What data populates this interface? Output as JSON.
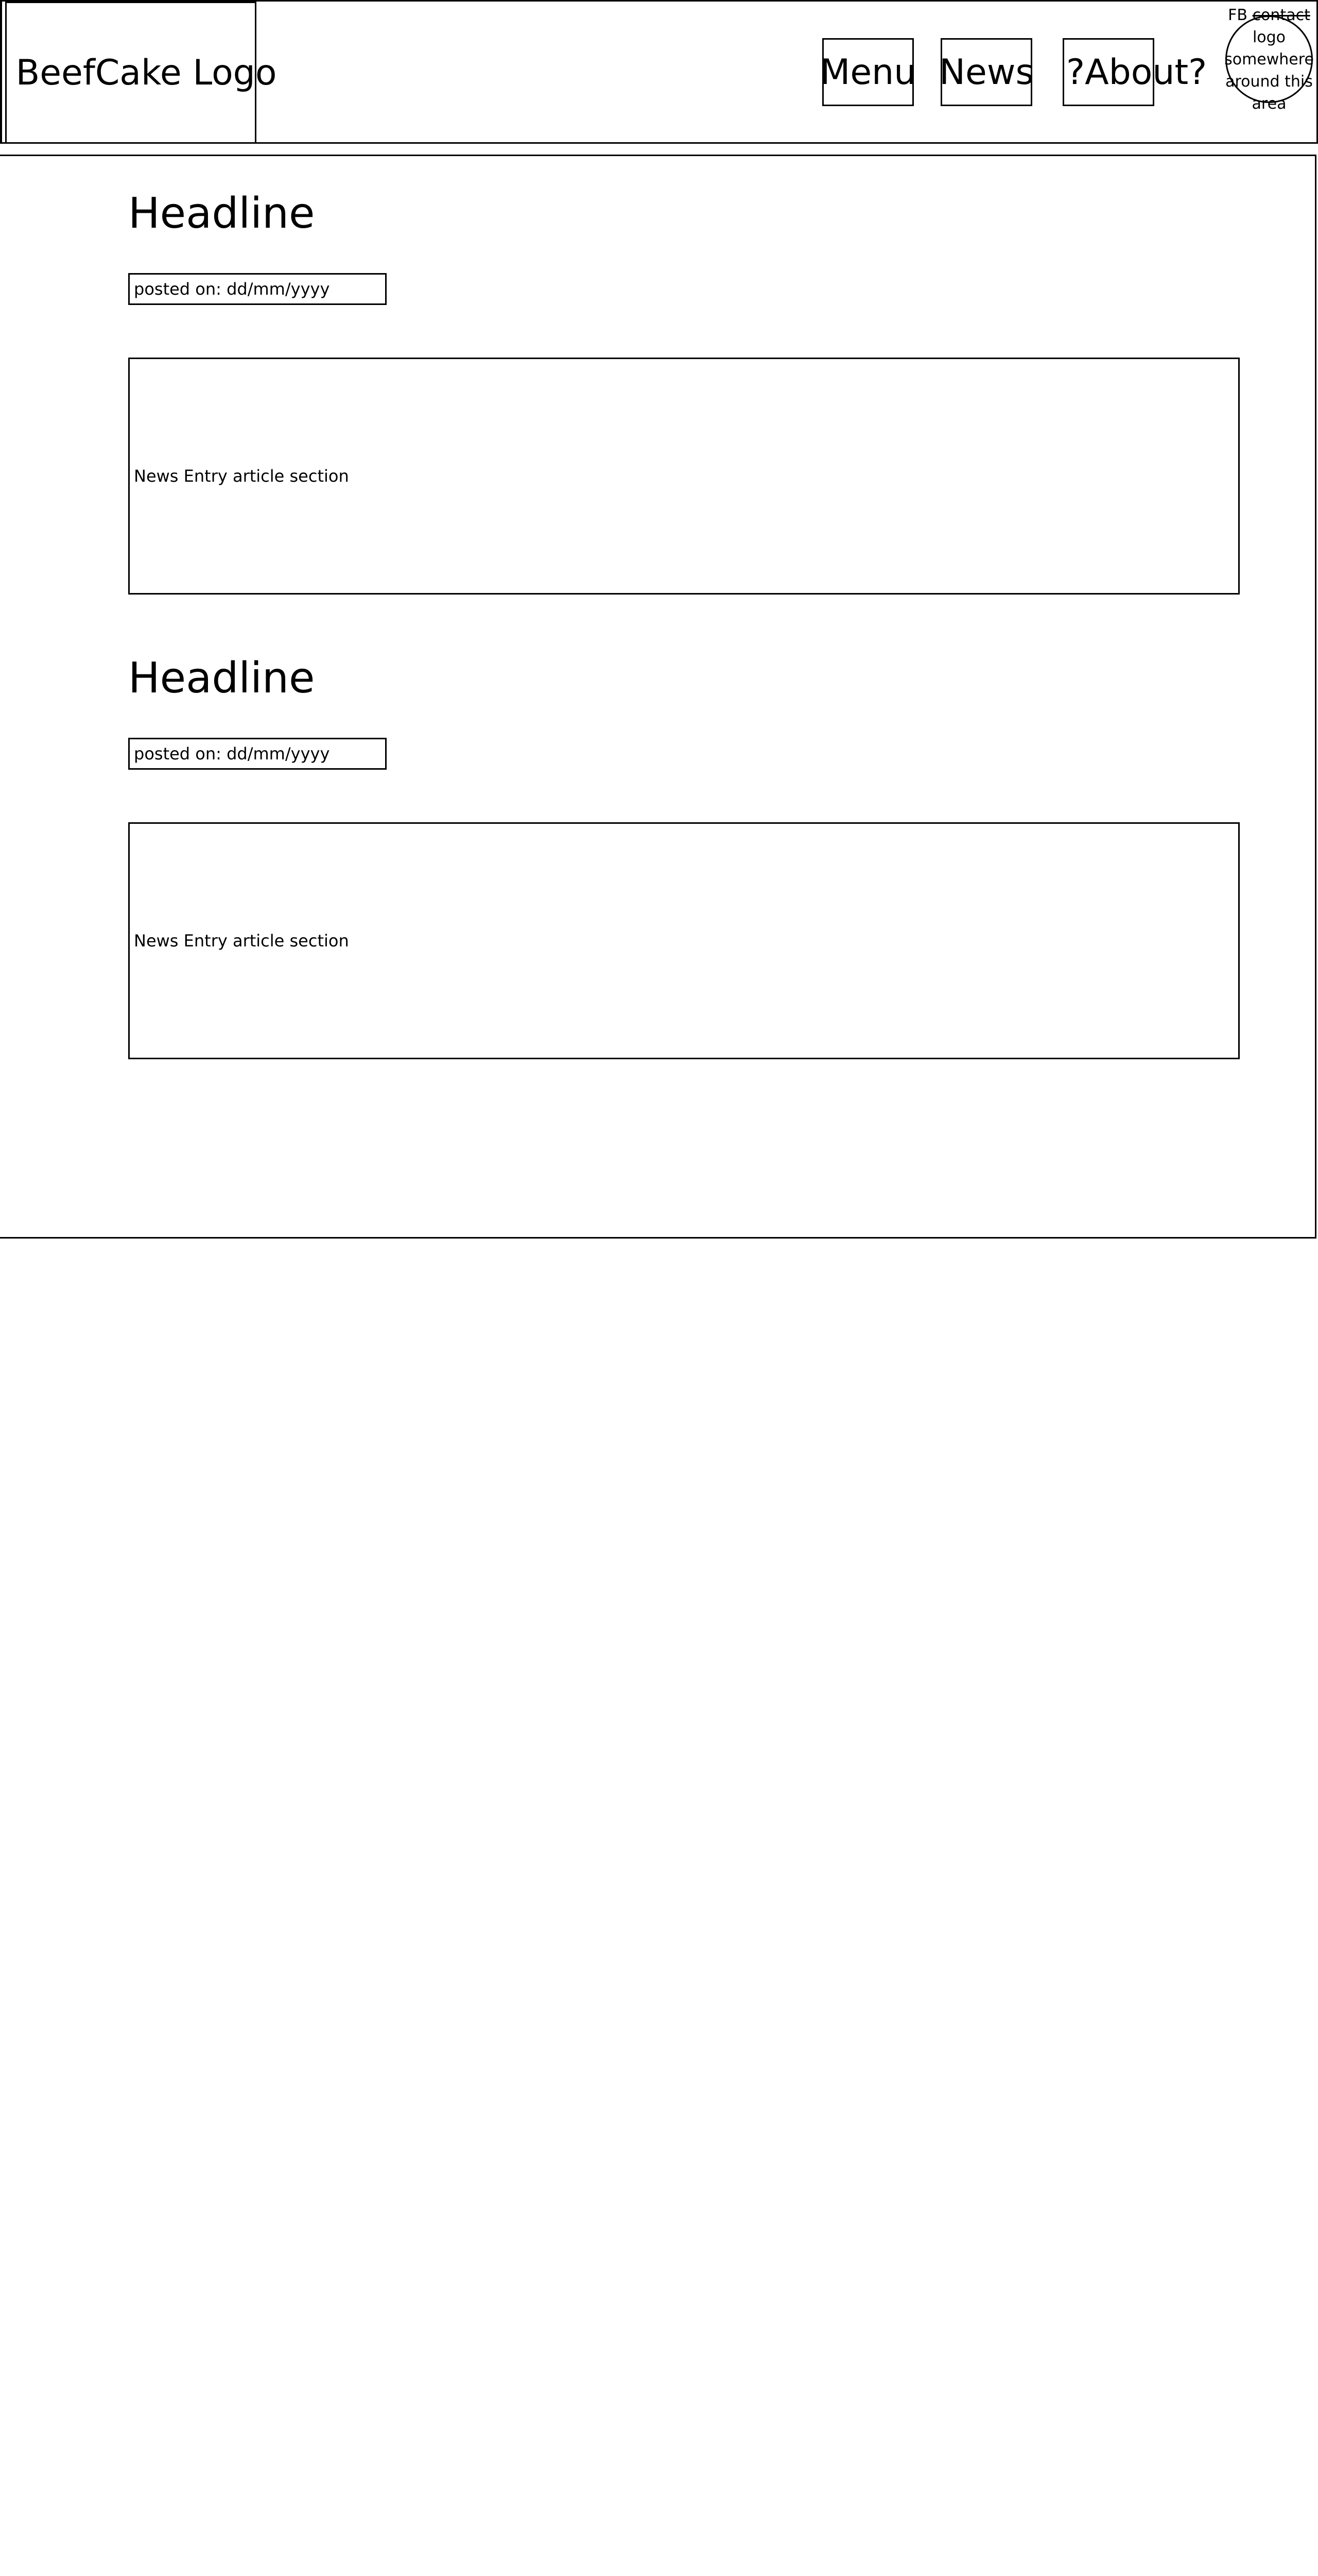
{
  "header": {
    "logo_text": "BeefCake Logo",
    "nav": {
      "menu": "Menu",
      "news": "News",
      "about": "?About?"
    },
    "fb_contact": {
      "line1_a": "FB",
      "line1_b": "contact",
      "line2": "logo",
      "line3": "somewhere",
      "line4": "around this",
      "line5": "area"
    }
  },
  "news_entries": [
    {
      "headline": "Headline",
      "posted": "posted on: dd/mm/yyyy",
      "article": "News Entry article section"
    },
    {
      "headline": "Headline",
      "posted": "posted on: dd/mm/yyyy",
      "article": "News Entry article section"
    }
  ]
}
